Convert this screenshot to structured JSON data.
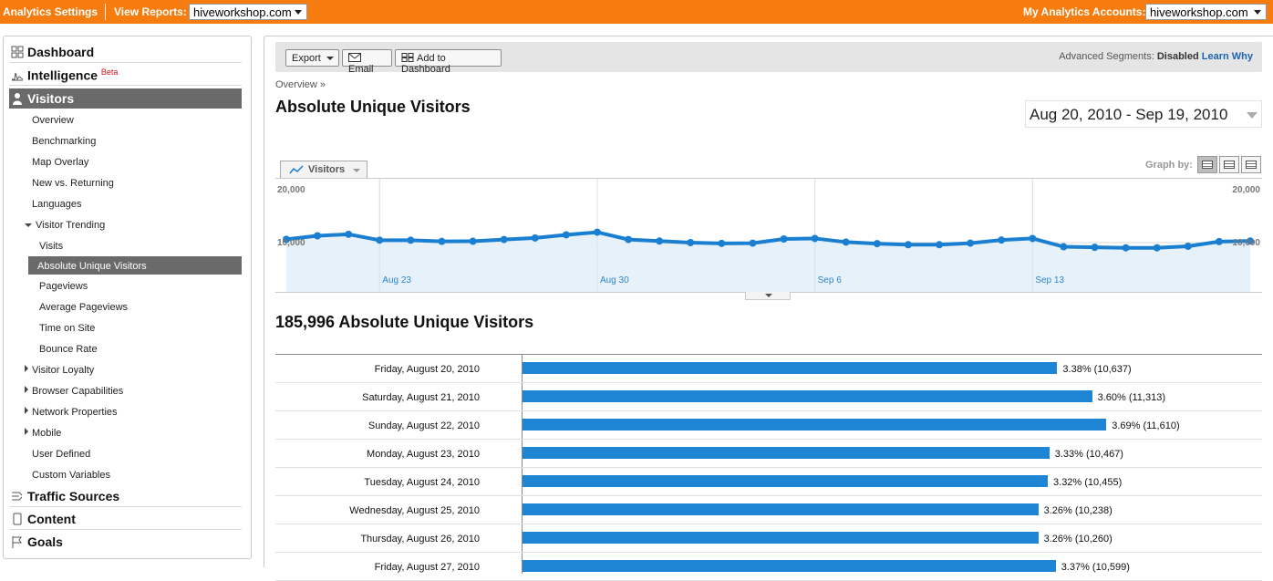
{
  "topbar": {
    "settings_label": "Analytics Settings",
    "view_reports_label": "View Reports:",
    "view_reports_value": "hiveworkshop.com",
    "accounts_label": "My Analytics Accounts:",
    "accounts_value": "hiveworkshop.com"
  },
  "sidebar": {
    "sections": {
      "dashboard": "Dashboard",
      "intelligence": "Intelligence",
      "intelligence_badge": "Beta",
      "visitors": "Visitors",
      "traffic_sources": "Traffic Sources",
      "content": "Content",
      "goals": "Goals"
    },
    "visitors_items": {
      "overview": "Overview",
      "benchmarking": "Benchmarking",
      "map_overlay": "Map Overlay",
      "new_vs_returning": "New vs. Returning",
      "languages": "Languages",
      "visitor_trending": "Visitor Trending",
      "visits": "Visits",
      "absolute_unique": "Absolute Unique Visitors",
      "pageviews": "Pageviews",
      "avg_pageviews": "Average Pageviews",
      "time_on_site": "Time on Site",
      "bounce_rate": "Bounce Rate",
      "visitor_loyalty": "Visitor Loyalty",
      "browser_capabilities": "Browser Capabilities",
      "network_properties": "Network Properties",
      "mobile": "Mobile",
      "user_defined": "User Defined",
      "custom_variables": "Custom Variables"
    }
  },
  "toolbar": {
    "export": "Export",
    "email": "Email",
    "add_dashboard": "Add to Dashboard",
    "adv_label": "Advanced Segments:",
    "adv_value": "Disabled",
    "learn_why": "Learn Why"
  },
  "page": {
    "breadcrumb": "Overview »",
    "title": "Absolute Unique Visitors",
    "date_range": "Aug 20, 2010 - Sep 19, 2010",
    "graph_tab": "Visitors",
    "graph_by": "Graph by:",
    "total": "185,996 Absolute Unique Visitors"
  },
  "chart_data": {
    "type": "line",
    "series": [
      {
        "values": [
          10637,
          11313,
          11610,
          10467,
          10455,
          10238,
          10260,
          10599,
          10900,
          11500,
          12000,
          10600,
          10300,
          10000,
          9850,
          9900,
          10700,
          10800,
          10100,
          9800,
          9600,
          9600,
          9900,
          10500,
          10800,
          9200,
          9100,
          9000,
          9000,
          9300,
          10200,
          10300
        ]
      }
    ],
    "y_tick_labels": [
      "20,000",
      "10,000"
    ],
    "ylim": [
      0,
      20000
    ],
    "x_tick_labels": [
      "Aug 23",
      "Aug 30",
      "Sep 6",
      "Sep 13"
    ],
    "x_tick_indices": [
      3,
      10,
      17,
      24
    ],
    "colors": {
      "line": "#1a7fd1",
      "area": "#e3f0fa"
    }
  },
  "table": {
    "rows": [
      {
        "date": "Friday, August 20, 2010",
        "pct": 3.38,
        "label": "3.38% (10,637)"
      },
      {
        "date": "Saturday, August 21, 2010",
        "pct": 3.6,
        "label": "3.60% (11,313)"
      },
      {
        "date": "Sunday, August 22, 2010",
        "pct": 3.69,
        "label": "3.69% (11,610)"
      },
      {
        "date": "Monday, August 23, 2010",
        "pct": 3.33,
        "label": "3.33% (10,467)"
      },
      {
        "date": "Tuesday, August 24, 2010",
        "pct": 3.32,
        "label": "3.32% (10,455)"
      },
      {
        "date": "Wednesday, August 25, 2010",
        "pct": 3.26,
        "label": "3.26% (10,238)"
      },
      {
        "date": "Thursday, August 26, 2010",
        "pct": 3.26,
        "label": "3.26% (10,260)"
      },
      {
        "date": "Friday, August 27, 2010",
        "pct": 3.37,
        "label": "3.37% (10,599)"
      }
    ]
  }
}
